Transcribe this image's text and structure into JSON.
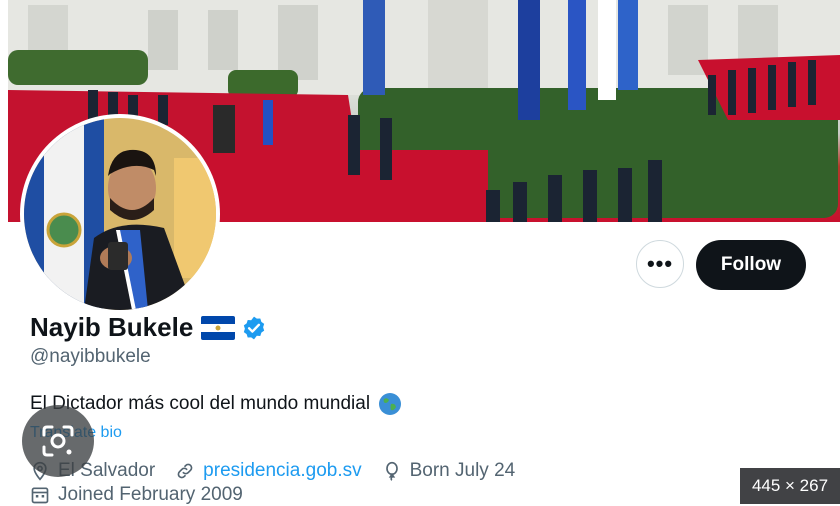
{
  "profile": {
    "name": "Nayib Bukele",
    "handle": "@nayibbukele",
    "bio": "El Dictador más cool del mundo mundial",
    "translate_label": "Translate bio",
    "location": "El Salvador",
    "website": "presidencia.gob.sv",
    "birthday": "Born July 24",
    "joined": "Joined February 2009"
  },
  "actions": {
    "more_label": "•••",
    "follow_label": "Follow"
  },
  "overlay": {
    "size_badge": "445 × 267"
  },
  "icons": {
    "flag": "el-salvador-flag-icon",
    "verified": "verified-badge-icon",
    "globe": "globe-icon",
    "location": "location-pin-icon",
    "link": "link-icon",
    "birthday": "balloon-icon",
    "joined": "calendar-icon",
    "lens": "google-lens-icon"
  },
  "colors": {
    "text_primary": "#0f1419",
    "text_secondary": "#536471",
    "link": "#1d9bf0",
    "follow_bg": "#0f1419",
    "verified": "#1d9bf0",
    "flag_blue": "#0047ab"
  }
}
